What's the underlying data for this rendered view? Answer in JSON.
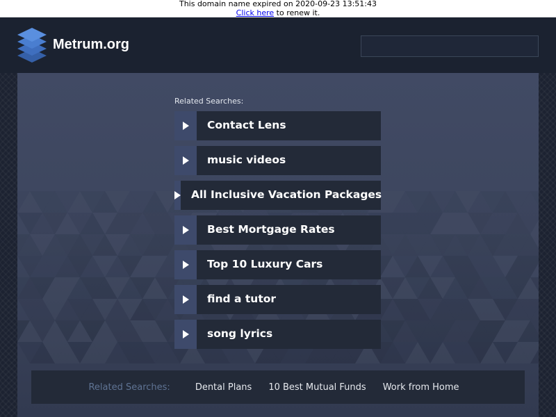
{
  "notice": {
    "expired_text": "This domain name expired on 2020-09-23 13:51:43",
    "renew_link": "Click here",
    "renew_suffix": " to renew it."
  },
  "header": {
    "site_name": "Metrum.org",
    "search_value": "",
    "logo_icon": "stacked-layers-icon"
  },
  "main": {
    "heading": "Related Searches:",
    "results": [
      {
        "label": "Contact Lens"
      },
      {
        "label": "music videos"
      },
      {
        "label": "All Inclusive Vacation Packages"
      },
      {
        "label": "Best Mortgage Rates"
      },
      {
        "label": "Top 10 Luxury Cars"
      },
      {
        "label": "find a tutor"
      },
      {
        "label": "song lyrics"
      }
    ]
  },
  "footer": {
    "title": "Related Searches:",
    "links": [
      "Dental Plans",
      "10 Best Mutual Funds",
      "Work from Home"
    ]
  },
  "colors": {
    "header_bg": "#1b2230",
    "panel_bg": "#414a64",
    "item_bg": "#232a38",
    "arrow_bg": "#3e4a6b",
    "footer_title": "#5f7393"
  }
}
